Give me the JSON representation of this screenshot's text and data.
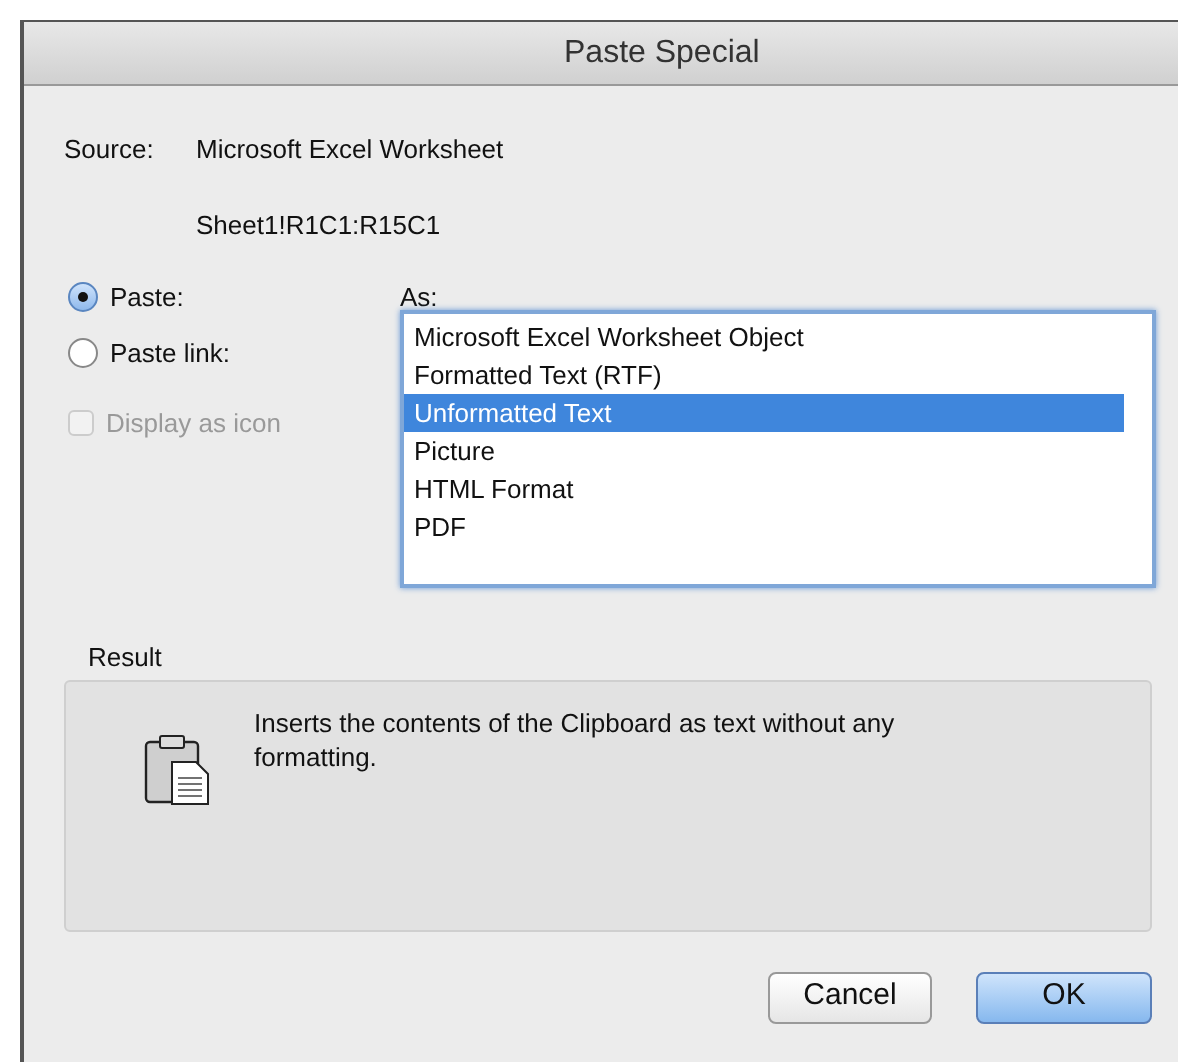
{
  "window": {
    "title": "Paste Special"
  },
  "source": {
    "label": "Source:",
    "value": "Microsoft Excel Worksheet",
    "range": "Sheet1!R1C1:R15C1"
  },
  "paste_options": [
    {
      "label": "Paste:",
      "selected": true
    },
    {
      "label": "Paste link:",
      "selected": false
    }
  ],
  "display_as_icon": {
    "label": "Display as icon",
    "checked": false,
    "disabled": true
  },
  "as": {
    "label": "As:",
    "items": [
      {
        "label": "Microsoft Excel Worksheet Object",
        "selected": false
      },
      {
        "label": "Formatted Text (RTF)",
        "selected": false
      },
      {
        "label": "Unformatted Text",
        "selected": true
      },
      {
        "label": "Picture",
        "selected": false
      },
      {
        "label": "HTML Format",
        "selected": false
      },
      {
        "label": "PDF",
        "selected": false
      }
    ]
  },
  "result": {
    "label": "Result",
    "text": "Inserts the contents of the Clipboard as text without any formatting."
  },
  "buttons": [
    {
      "label": "Cancel",
      "default": false
    },
    {
      "label": "OK",
      "default": true
    }
  ]
}
